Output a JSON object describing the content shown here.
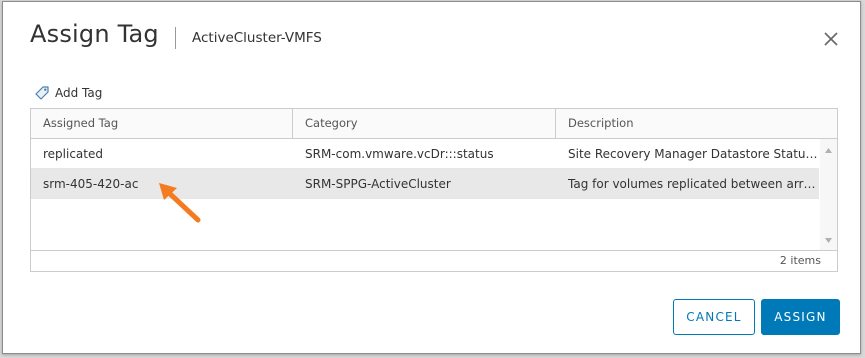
{
  "dialog": {
    "title": "Assign Tag",
    "subtitle": "ActiveCluster-VMFS",
    "close_icon": "close-icon"
  },
  "toolbar": {
    "add_tag_label": "Add Tag",
    "add_tag_icon": "tag-icon"
  },
  "table": {
    "columns": [
      "Assigned Tag",
      "Category",
      "Description"
    ],
    "rows": [
      {
        "tag": "replicated",
        "category": "SRM-com.vmware.vcDr:::status",
        "description": "Site Recovery Manager Datastore Status:...",
        "selected": false
      },
      {
        "tag": "srm-405-420-ac",
        "category": "SRM-SPPG-ActiveCluster",
        "description": "Tag for volumes replicated between array...",
        "selected": true
      }
    ],
    "item_count": "2 items"
  },
  "buttons": {
    "cancel": "CANCEL",
    "assign": "ASSIGN"
  },
  "colors": {
    "accent": "#0079b8",
    "annotation_arrow": "#f47b20",
    "selected_row": "#e8e8e8"
  }
}
